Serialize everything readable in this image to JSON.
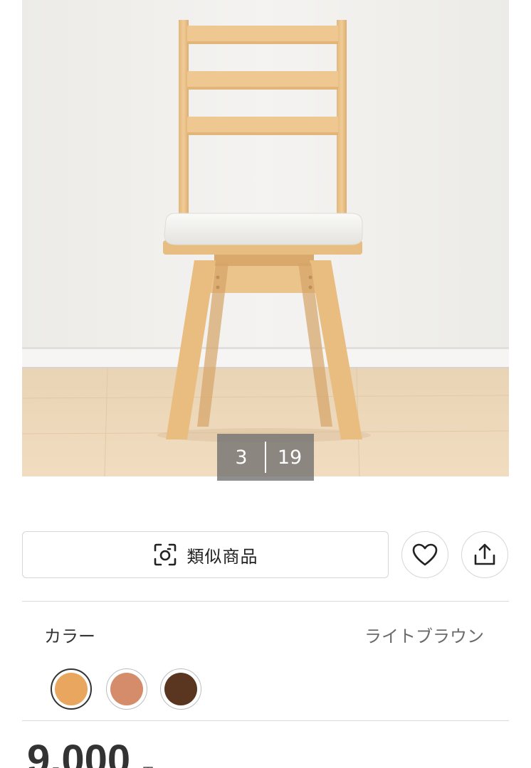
{
  "gallery": {
    "current": "3",
    "total": "19"
  },
  "actions": {
    "similar_label": "類似商品",
    "similar_icon": "camera-scan-icon",
    "favorite_icon": "heart-icon",
    "share_icon": "share-icon"
  },
  "color": {
    "label": "カラー",
    "selected_name": "ライトブラウン",
    "swatches": [
      {
        "color": "#E9A65E",
        "selected": true
      },
      {
        "color": "#D58C6B",
        "selected": false
      },
      {
        "color": "#5A3620",
        "selected": false
      }
    ]
  },
  "price": {
    "amount": "9,000",
    "unit": "円"
  }
}
